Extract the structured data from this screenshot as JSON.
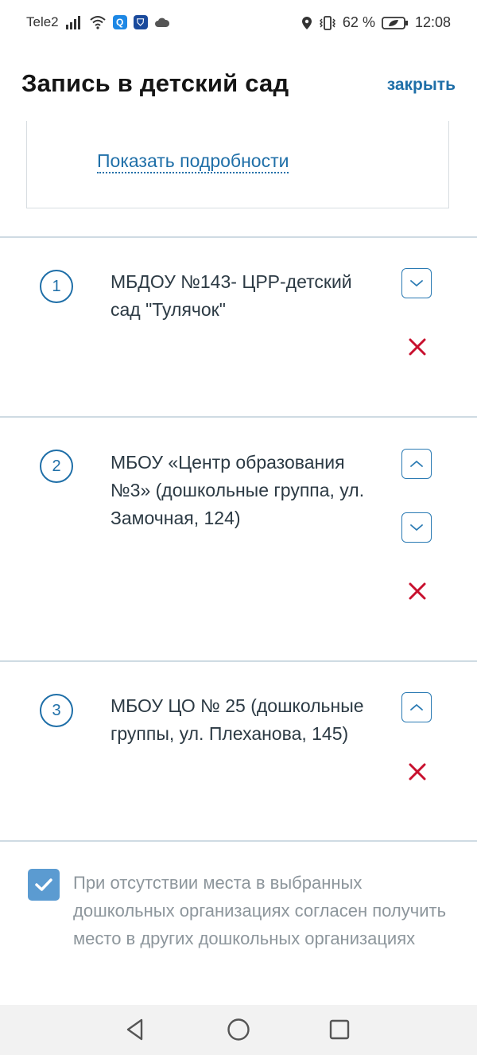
{
  "status_bar": {
    "carrier": "Tele2",
    "battery": "62 %",
    "time": "12:08"
  },
  "header": {
    "title": "Запись в детский сад",
    "close_label": "закрыть"
  },
  "details": {
    "show_details_label": "Показать подробности"
  },
  "kindergartens": [
    {
      "number": "1",
      "name": "МБДОУ №143- ЦРР-детский сад \"Тулячок\""
    },
    {
      "number": "2",
      "name": "МБОУ «Центр образования №3» (дошкольные группа, ул. Замочная, 124)"
    },
    {
      "number": "3",
      "name": "МБОУ ЦО № 25 (дошкольные группы, ул. Плеханова, 145)"
    }
  ],
  "consent": {
    "checked": true,
    "text": "При отсутствии места в выбранных дошкольных организациях согласен получить место в других дошкольных организациях"
  },
  "colors": {
    "accent": "#1f6fa8",
    "remove": "#c8102e",
    "checkbox": "#5b9bd1",
    "divider": "#cfdbe3"
  },
  "icons": {
    "move_up": "chevron-up-icon",
    "move_down": "chevron-down-icon",
    "remove": "close-icon",
    "nav_back": "triangle-back-icon",
    "nav_home": "circle-home-icon",
    "nav_recents": "square-recents-icon"
  }
}
